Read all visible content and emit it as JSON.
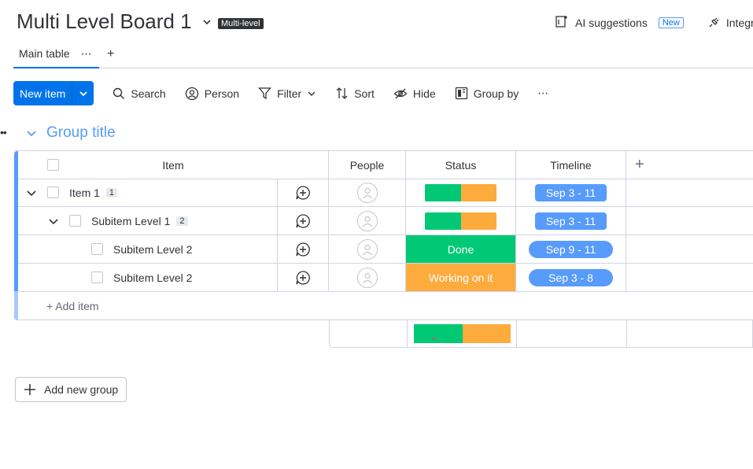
{
  "header": {
    "title": "Multi Level Board 1",
    "badge": "Multi-level",
    "ai_label": "AI suggestions",
    "new_badge": "New",
    "integrate_label": "Integr"
  },
  "tabs": {
    "main": "Main table",
    "more": "⋯",
    "add": "+"
  },
  "toolbar": {
    "new_item": "New item",
    "search": "Search",
    "person": "Person",
    "filter": "Filter",
    "sort": "Sort",
    "hide": "Hide",
    "group_by": "Group by",
    "more": "⋯"
  },
  "group": {
    "title": "Group title",
    "columns": {
      "item": "Item",
      "people": "People",
      "status": "Status",
      "timeline": "Timeline",
      "add": "+"
    },
    "rows": [
      {
        "name": "Item 1",
        "count": "1",
        "level": 0,
        "status": "battery",
        "timeline": "Sep 3 - 11"
      },
      {
        "name": "Subitem Level 1",
        "count": "2",
        "level": 1,
        "status": "battery",
        "timeline": "Sep 3 - 11"
      },
      {
        "name": "Subitem Level 2",
        "count": "",
        "level": 2,
        "status": "Done",
        "timeline": "Sep 9 - 11"
      },
      {
        "name": "Subitem Level 2",
        "count": "",
        "level": 2,
        "status": "Working on it",
        "timeline": "Sep 3 - 8"
      }
    ],
    "add_item": "+ Add item"
  },
  "add_group": "Add new group",
  "colors": {
    "accent": "#0073ea",
    "group": "#579bfc",
    "done": "#00c875",
    "working": "#fdab3d"
  }
}
